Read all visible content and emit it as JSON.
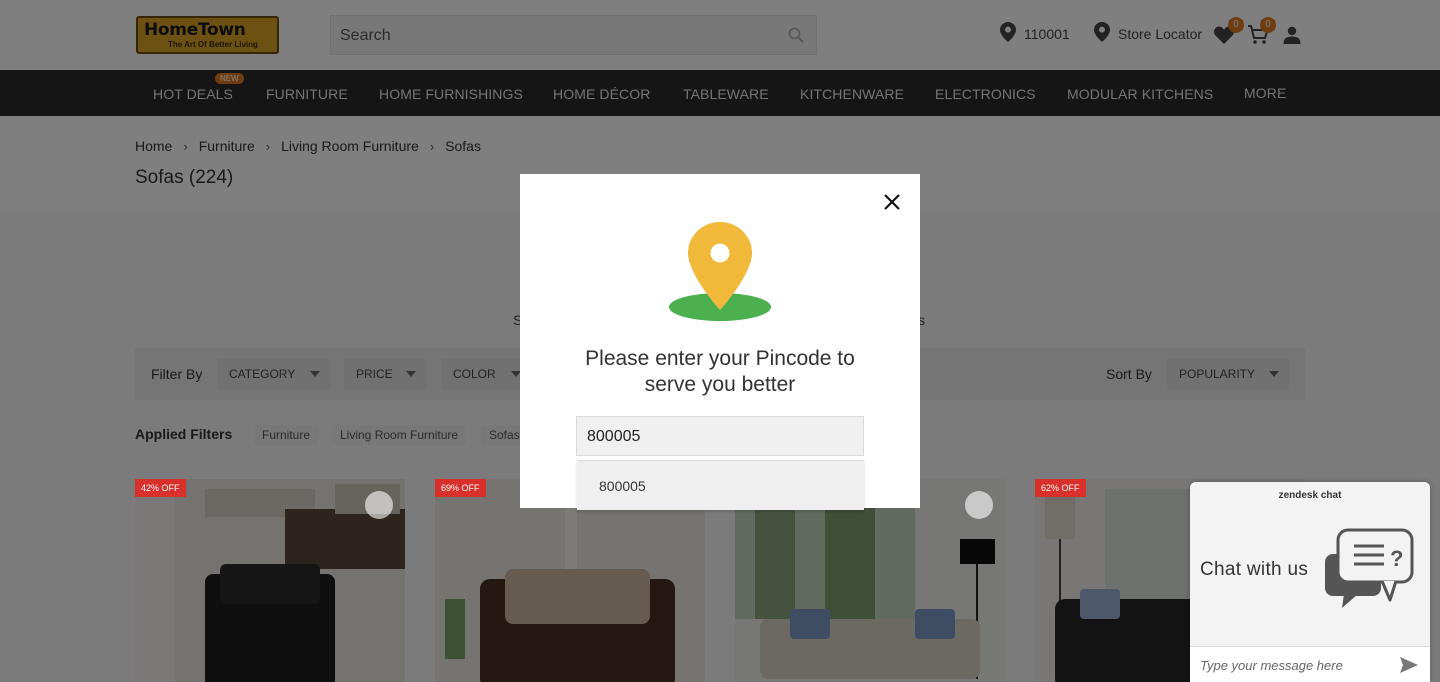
{
  "header": {
    "logo_main": "HomeTown",
    "logo_tagline": "The Art Of Better Living",
    "search_placeholder": "Search",
    "pincode": "110001",
    "store_locator": "Store Locator",
    "wishlist_count": "0",
    "cart_count": "0"
  },
  "nav": {
    "items": [
      "HOT DEALS",
      "FURNITURE",
      "HOME FURNISHINGS",
      "HOME DÉCOR",
      "TABLEWARE",
      "KITCHENWARE",
      "ELECTRONICS",
      "MODULAR KITCHENS",
      "MORE"
    ],
    "new_badge": "NEW"
  },
  "breadcrumb": [
    "Home",
    "Furniture",
    "Living Room Furniture",
    "Sofas"
  ],
  "page_title": "Sofas (224)",
  "partial_text": {
    "left": "S",
    "right": "s"
  },
  "filters": {
    "filter_by_label": "Filter By",
    "dropdowns": [
      "CATEGORY",
      "PRICE",
      "COLOR"
    ],
    "sort_by_label": "Sort By",
    "sort_value": "POPULARITY",
    "applied_label": "Applied Filters",
    "applied": [
      "Furniture",
      "Living Room Furniture",
      "Sofas"
    ]
  },
  "products": [
    {
      "discount": "42% OFF"
    },
    {
      "discount": "69% OFF"
    },
    {
      "discount": ""
    },
    {
      "discount": "62% OFF"
    }
  ],
  "modal": {
    "message_line1": "Please enter your Pincode to",
    "message_line2": "serve you better",
    "input_value": "800005",
    "suggestion": "800005"
  },
  "chat": {
    "brand": "zendesk chat",
    "title": "Chat with us",
    "input_placeholder": "Type your message here"
  },
  "colors": {
    "nav_bg": "#2b2b2b",
    "accent": "#e07b20",
    "pin_yellow": "#f0b93a",
    "pin_ground": "#4caf50",
    "discount_red": "#d9302b"
  }
}
